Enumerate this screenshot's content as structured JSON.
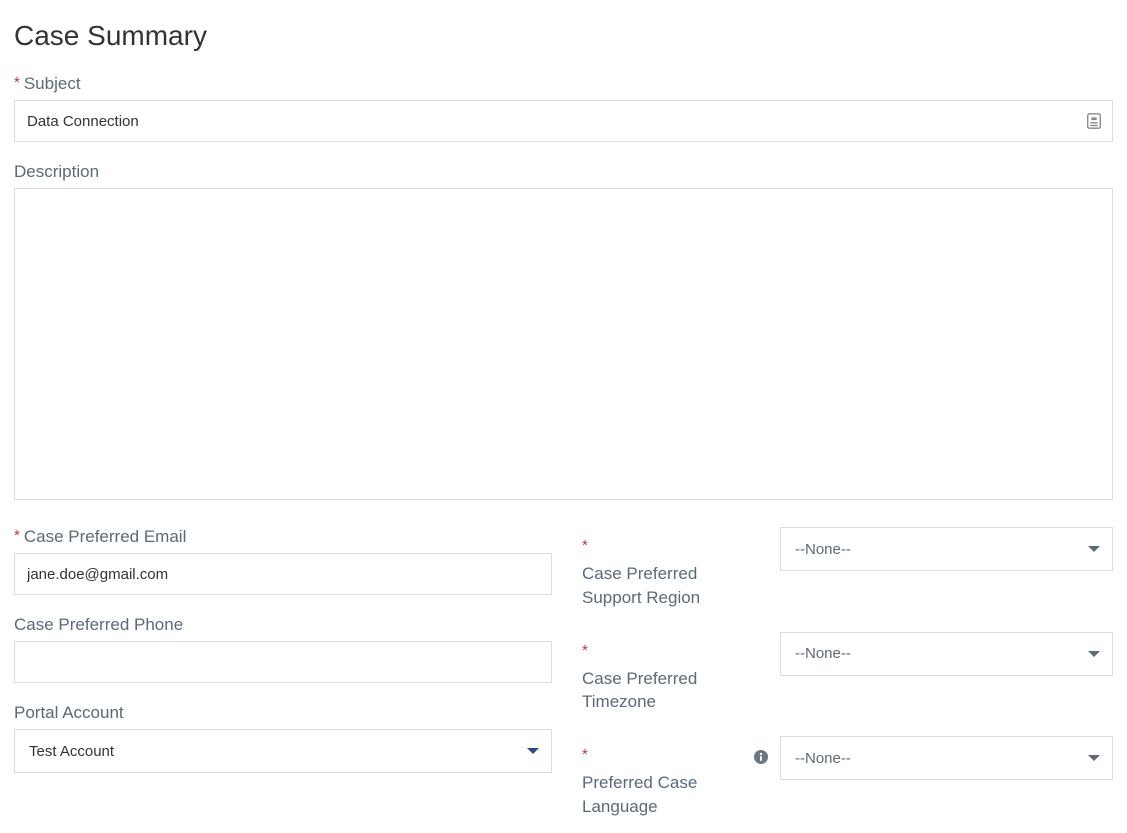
{
  "title": "Case Summary",
  "subject": {
    "label": "Subject",
    "required": true,
    "value": "Data Connection"
  },
  "description": {
    "label": "Description",
    "required": false,
    "value": ""
  },
  "email": {
    "label": "Case Preferred Email",
    "required": true,
    "value": "jane.doe@gmail.com"
  },
  "phone": {
    "label": "Case Preferred Phone",
    "required": false,
    "value": ""
  },
  "portal_account": {
    "label": "Portal Account",
    "required": false,
    "selected": "Test Account"
  },
  "support_region": {
    "label": "Case Preferred Support Region",
    "required": true,
    "selected": "--None--"
  },
  "timezone": {
    "label": "Case Preferred Timezone",
    "required": true,
    "selected": "--None--"
  },
  "language": {
    "label": "Preferred Case Language",
    "required": true,
    "selected": "--None--",
    "has_info": true
  },
  "asterisk": "*"
}
